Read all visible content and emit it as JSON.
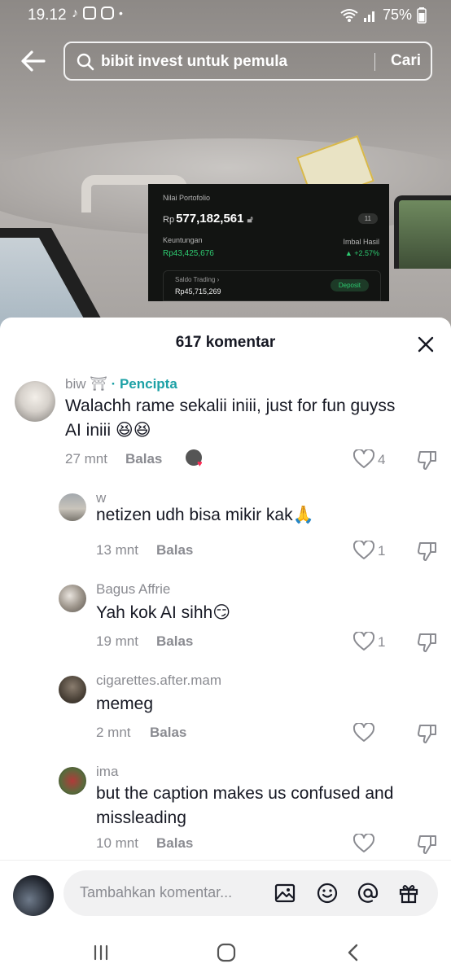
{
  "status_bar": {
    "time": "19.12",
    "battery": "75%",
    "dot": "•"
  },
  "search": {
    "query": "bibit invest untuk pemula",
    "button_label": "Cari"
  },
  "video_overlay": {
    "portfolio_label": "Nilai Portofolio",
    "portfolio_currency": "Rp",
    "portfolio_value": "577,182,561",
    "portfolio_badge": "11",
    "gain_label": "Keuntungan",
    "gain_value": "Rp43,425,676",
    "return_label": "Imbal Hasil",
    "return_value": "▲ +2.57%",
    "trading_label": "Saldo Trading ›",
    "trading_value": "Rp45,715,269",
    "deposit_label": "Deposit"
  },
  "panel": {
    "title": "617 komentar"
  },
  "comments": [
    {
      "user": "biw ⛩",
      "tag": "· Pencipta",
      "text_line1": "Walachh rame sekalii iniii, just for fun guyss",
      "text_line2": "AI iniii 😆😆",
      "time": "27 mnt",
      "reply": "Balas",
      "likes": "4"
    },
    {
      "user": "w",
      "text": "netizen udh bisa mikir kak🙏",
      "time": "13 mnt",
      "reply": "Balas",
      "likes": "1"
    },
    {
      "user": "Bagus Affrie",
      "text": "Yah kok AI sihh😏",
      "time": "19 mnt",
      "reply": "Balas",
      "likes": "1"
    },
    {
      "user": "cigarettes.after.mam",
      "text": "memeg",
      "time": "2 mnt",
      "reply": "Balas",
      "likes": ""
    },
    {
      "user": "ima",
      "text_line1": "but the caption makes us confused and",
      "text_line2": "missleading",
      "time": "10 mnt",
      "reply": "Balas",
      "likes": ""
    }
  ],
  "input": {
    "placeholder": "Tambahkan komentar..."
  },
  "colors": {
    "creator_tag": "#1da1a6",
    "like_heart": "#fe2c55",
    "text_primary": "#161823",
    "text_secondary": "#8a8b91",
    "gain_green": "#2ecc71"
  }
}
